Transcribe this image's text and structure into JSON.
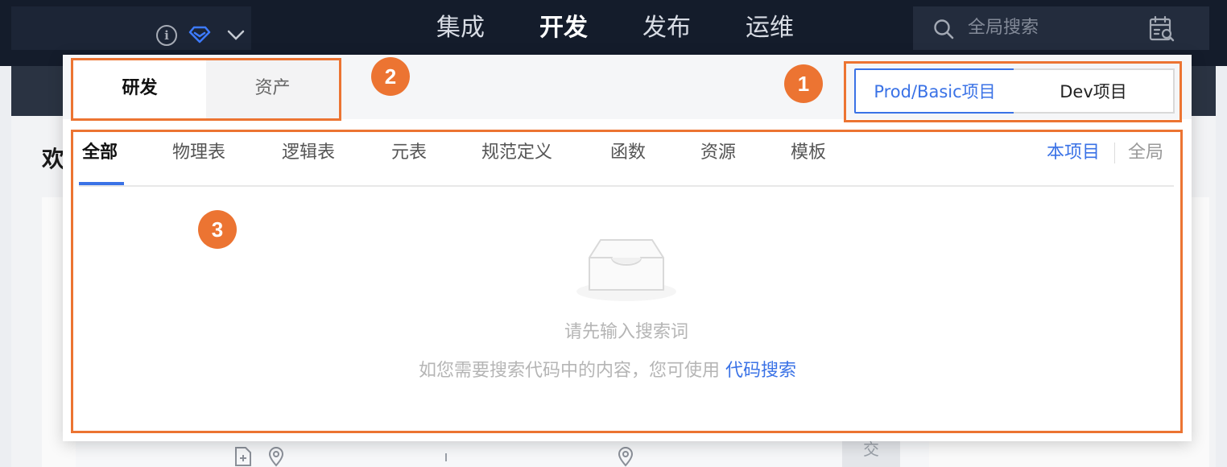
{
  "top_nav": {
    "items": [
      "集成",
      "开发",
      "发布",
      "运维"
    ],
    "active_index": 1
  },
  "global_search": {
    "placeholder": "全局搜索"
  },
  "page": {
    "heading_partial": "欢",
    "bottom_char": "交"
  },
  "popover": {
    "scope_tabs": [
      "研发",
      "资产"
    ],
    "scope_active": "研发",
    "project_toggle": {
      "prod_label": "Prod/Basic项目",
      "dev_label": "Dev项目",
      "selected": "Prod/Basic项目"
    },
    "type_tabs": [
      "全部",
      "物理表",
      "逻辑表",
      "元表",
      "规范定义",
      "函数",
      "资源",
      "模板"
    ],
    "type_active": "全部",
    "range": {
      "current": "本项目",
      "other": "全局"
    },
    "empty": {
      "title": "请先输入搜索词",
      "hint_prefix": "如您需要搜索代码中的内容，您可使用",
      "hint_link": "代码搜索"
    }
  },
  "annotations": [
    "1",
    "2",
    "3"
  ],
  "colors": {
    "accent": "#3a72e6",
    "annotation": "#ec7432",
    "topbar": "#141c2b"
  },
  "icons": [
    "info-icon",
    "diamond-icon",
    "chevron-down-icon",
    "search-icon",
    "calendar-search-icon",
    "empty-inbox-icon",
    "add-file-icon",
    "location-pin-icon"
  ]
}
